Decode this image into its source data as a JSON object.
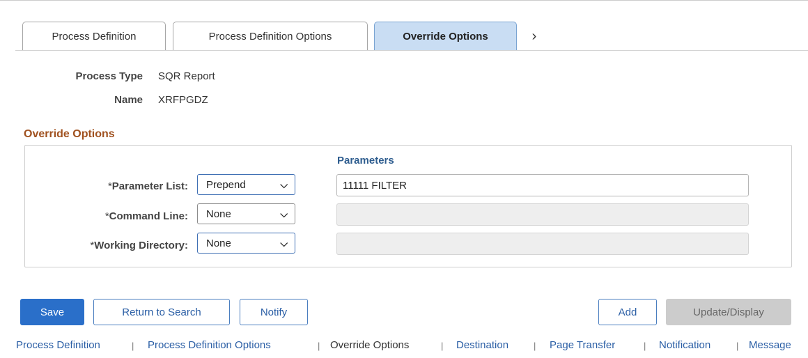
{
  "tabs": [
    {
      "label": "Process Definition",
      "active": false
    },
    {
      "label": "Process Definition Options",
      "active": false
    },
    {
      "label": "Override Options",
      "active": true
    }
  ],
  "tab_next_icon": "chevron-right-icon",
  "header": {
    "process_type_label": "Process Type",
    "process_type_value": "SQR Report",
    "name_label": "Name",
    "name_value": "XRFPGDZ"
  },
  "override": {
    "title": "Override Options",
    "parameters_header": "Parameters",
    "rows": [
      {
        "required": "*",
        "label": "Parameter List:",
        "selected": "Prepend",
        "parameters": "11111 FILTER",
        "parameters_enabled": true
      },
      {
        "required": "*",
        "label": "Command Line:",
        "selected": "None",
        "parameters": "",
        "parameters_enabled": false
      },
      {
        "required": "*",
        "label": "Working Directory:",
        "selected": "None",
        "parameters": "",
        "parameters_enabled": false
      }
    ]
  },
  "buttons": {
    "save": "Save",
    "return_to_search": "Return to Search",
    "notify": "Notify",
    "add": "Add",
    "update_display": "Update/Display"
  },
  "footer_links": [
    {
      "label": "Process Definition",
      "current": false
    },
    {
      "label": "Process Definition Options",
      "current": false
    },
    {
      "label": "Override Options",
      "current": true
    },
    {
      "label": "Destination",
      "current": false
    },
    {
      "label": "Page Transfer",
      "current": false
    },
    {
      "label": "Notification",
      "current": false
    },
    {
      "label": "Message",
      "current": false
    }
  ],
  "footer_separator": "|",
  "colors": {
    "active_tab": "#c9ddf3",
    "primary_button": "#2a6fc9",
    "group_title": "#a0511f",
    "link": "#2a5ea5"
  }
}
